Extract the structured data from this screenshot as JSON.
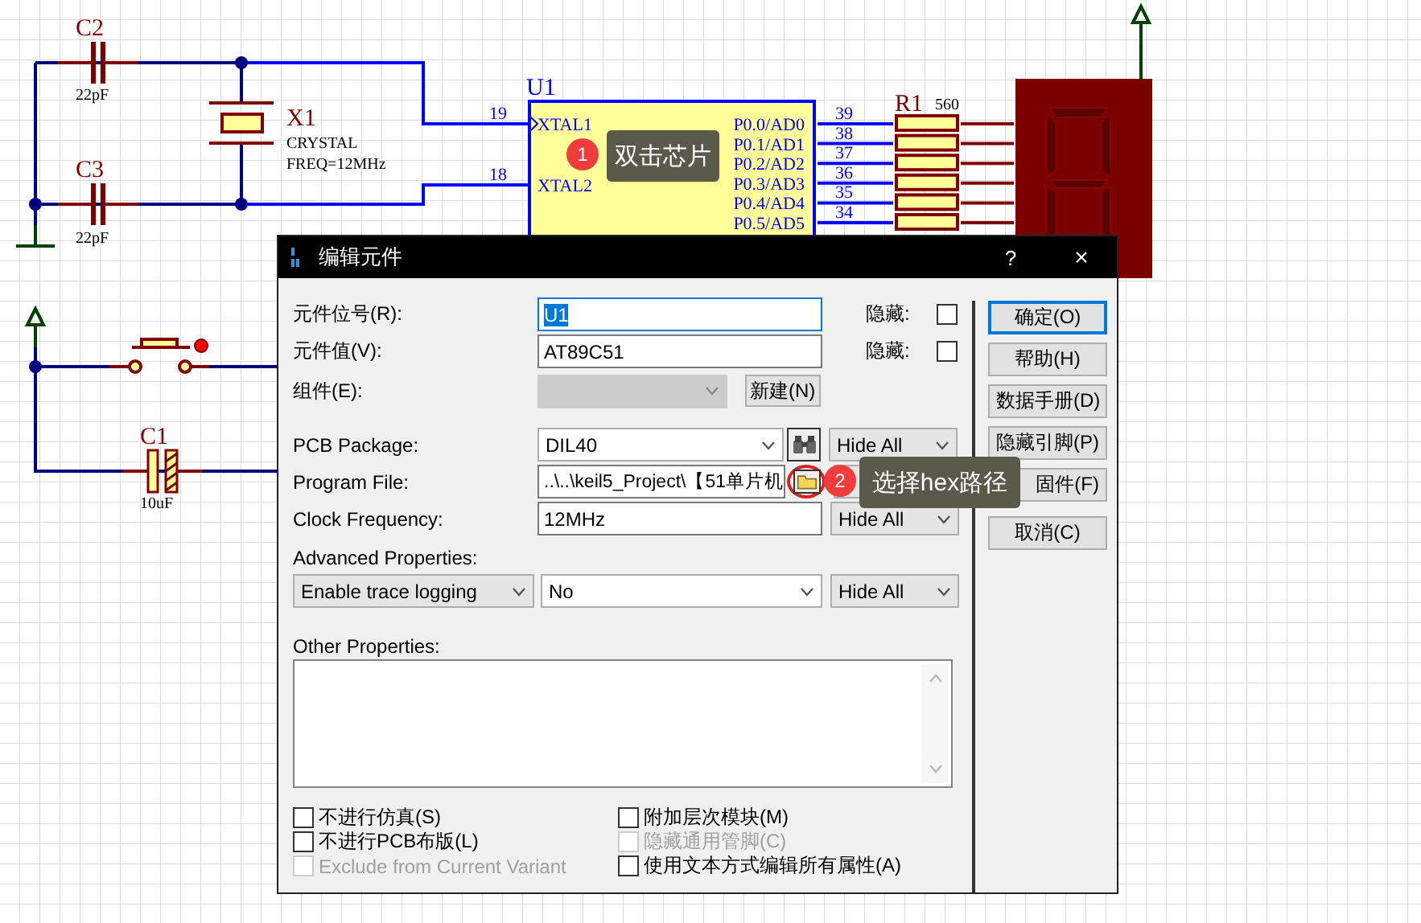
{
  "schematic": {
    "capacitors": [
      {
        "ref": "C2",
        "value": "22pF",
        "kind": "ceramic"
      },
      {
        "ref": "C3",
        "value": "22pF",
        "kind": "ceramic"
      },
      {
        "ref": "C1",
        "value": "10uF",
        "kind": "electrolytic"
      }
    ],
    "crystal": {
      "ref": "X1",
      "type": "CRYSTAL",
      "frequency": "FREQ=12MHz"
    },
    "chip": {
      "ref": "U1",
      "left_pins": [
        {
          "number": "19",
          "name": "XTAL1"
        },
        {
          "number": "18",
          "name": "XTAL2"
        }
      ],
      "right_pins": [
        {
          "number": "39",
          "name": "P0.0/AD0"
        },
        {
          "number": "38",
          "name": "P0.1/AD1"
        },
        {
          "number": "37",
          "name": "P0.2/AD2"
        },
        {
          "number": "36",
          "name": "P0.3/AD3"
        },
        {
          "number": "35",
          "name": "P0.4/AD4"
        },
        {
          "number": "34",
          "name": "P0.5/AD5"
        }
      ]
    },
    "resistor": {
      "ref": "R1",
      "value": "560"
    }
  },
  "callouts": [
    {
      "number": "1",
      "text": "双击芯片"
    },
    {
      "number": "2",
      "text": "选择hex路径"
    }
  ],
  "dialog": {
    "title": "编辑元件",
    "help": "?",
    "close": "×",
    "top_fields": [
      {
        "label": "元件位号(R):",
        "value": "U1",
        "focused": true,
        "hide_label": "隐藏:",
        "hidden": false
      },
      {
        "label": "元件值(V):",
        "value": "AT89C51",
        "focused": false,
        "hide_label": "隐藏:",
        "hidden": false
      }
    ],
    "part": {
      "label": "组件(E):",
      "disabled": true,
      "button": "新建(N)"
    },
    "properties": [
      {
        "label": "PCB Package:",
        "kind": "dropdown",
        "value": "DIL40",
        "visibility": "Hide All"
      },
      {
        "label": "Program File:",
        "kind": "file",
        "value": "..\\..\\keil5_Project\\【51单片机",
        "highlighted": true
      },
      {
        "label": "Clock Frequency:",
        "kind": "text",
        "value": "12MHz",
        "visibility": "Hide All"
      }
    ],
    "advanced": {
      "label": "Advanced Properties:",
      "name": "Enable trace logging",
      "value": "No",
      "visibility": "Hide All"
    },
    "other": {
      "label": "Other Properties:"
    },
    "left_options": [
      {
        "label": "不进行仿真(S)",
        "checked": false,
        "disabled": false
      },
      {
        "label": "不进行PCB布版(L)",
        "checked": false,
        "disabled": false
      },
      {
        "label": "Exclude from Current Variant",
        "checked": false,
        "disabled": true
      }
    ],
    "right_options": [
      {
        "label": "附加层次模块(M)",
        "checked": false,
        "disabled": false
      },
      {
        "label": "隐藏通用管脚(C)",
        "checked": false,
        "disabled": true
      },
      {
        "label": "使用文本方式编辑所有属性(A)",
        "checked": false,
        "disabled": false
      }
    ],
    "buttons": [
      {
        "label": "确定(O)",
        "default": true
      },
      {
        "label": "帮助(H)",
        "default": false
      },
      {
        "label": "数据手册(D)",
        "default": false
      },
      {
        "label": "隐藏引脚(P)",
        "default": false
      },
      {
        "label": "固件(F)",
        "default": false
      },
      {
        "label": "取消(C)",
        "default": false
      }
    ]
  }
}
